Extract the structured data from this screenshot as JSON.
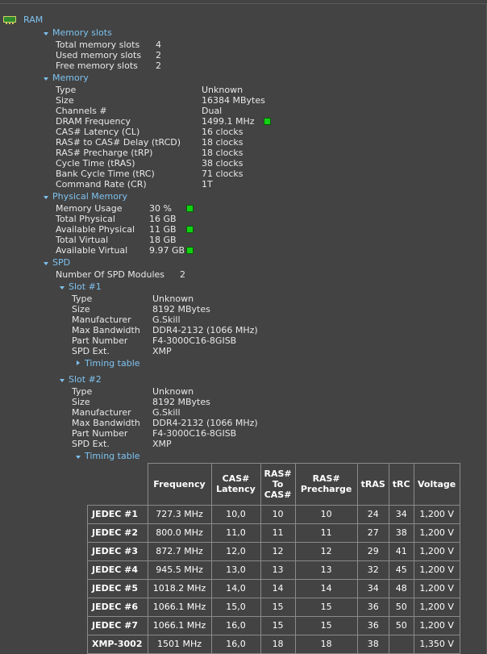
{
  "root": {
    "label": "RAM",
    "icon": "ram-icon"
  },
  "memory_slots": {
    "title": "Memory slots",
    "rows": [
      {
        "label": "Total memory slots",
        "value": "4"
      },
      {
        "label": "Used memory slots",
        "value": "2"
      },
      {
        "label": "Free memory slots",
        "value": "2"
      }
    ]
  },
  "memory": {
    "title": "Memory",
    "rows": [
      {
        "label": "Type",
        "value": "Unknown"
      },
      {
        "label": "Size",
        "value": "16384 MBytes"
      },
      {
        "label": "Channels #",
        "value": "Dual"
      },
      {
        "label": "DRAM Frequency",
        "value": "1499.1 MHz"
      },
      {
        "label": "CAS# Latency (CL)",
        "value": "16 clocks"
      },
      {
        "label": "RAS# to CAS# Delay (tRCD)",
        "value": "18 clocks"
      },
      {
        "label": "RAS# Precharge (tRP)",
        "value": "18 clocks"
      },
      {
        "label": "Cycle Time (tRAS)",
        "value": "38 clocks"
      },
      {
        "label": "Bank Cycle Time (tRC)",
        "value": "71 clocks"
      },
      {
        "label": "Command Rate (CR)",
        "value": "1T"
      }
    ]
  },
  "physical_memory": {
    "title": "Physical Memory",
    "rows": [
      {
        "label": "Memory Usage",
        "value": "30 %"
      },
      {
        "label": "Total Physical",
        "value": "16 GB"
      },
      {
        "label": "Available Physical",
        "value": "11 GB"
      },
      {
        "label": "Total Virtual",
        "value": "18 GB"
      },
      {
        "label": "Available Virtual",
        "value": "9.97 GB"
      }
    ]
  },
  "spd": {
    "title": "SPD",
    "modules_label": "Number Of SPD Modules",
    "modules_value": "2",
    "slot1": {
      "title": "Slot #1",
      "rows": [
        {
          "label": "Type",
          "value": "Unknown"
        },
        {
          "label": "Size",
          "value": "8192 MBytes"
        },
        {
          "label": "Manufacturer",
          "value": "G.Skill"
        },
        {
          "label": "Max Bandwidth",
          "value": "DDR4-2132 (1066 MHz)"
        },
        {
          "label": "Part Number",
          "value": "F4-3000C16-8GISB"
        },
        {
          "label": "SPD Ext.",
          "value": "XMP"
        }
      ],
      "timing_label": "Timing table"
    },
    "slot2": {
      "title": "Slot #2",
      "rows": [
        {
          "label": "Type",
          "value": "Unknown"
        },
        {
          "label": "Size",
          "value": "8192 MBytes"
        },
        {
          "label": "Manufacturer",
          "value": "G.Skill"
        },
        {
          "label": "Max Bandwidth",
          "value": "DDR4-2132 (1066 MHz)"
        },
        {
          "label": "Part Number",
          "value": "F4-3000C16-8GISB"
        },
        {
          "label": "SPD Ext.",
          "value": "XMP"
        }
      ],
      "timing_label": "Timing table"
    }
  },
  "timing_table": {
    "headers": {
      "frequency": "Frequency",
      "cas1": "CAS#",
      "cas2": "Latency",
      "rascas1": "RAS#",
      "rascas2": "To",
      "rascas3": "CAS#",
      "rasp1": "RAS#",
      "rasp2": "Precharge",
      "tras": "tRAS",
      "trc": "tRC",
      "voltage": "Voltage"
    },
    "rows": [
      {
        "name": "JEDEC #1",
        "freq": "727.3 MHz",
        "cl": "10,0",
        "rcd": "10",
        "rp": "10",
        "tras": "24",
        "trc": "34",
        "volt": "1,200 V"
      },
      {
        "name": "JEDEC #2",
        "freq": "800.0 MHz",
        "cl": "11,0",
        "rcd": "11",
        "rp": "11",
        "tras": "27",
        "trc": "38",
        "volt": "1,200 V"
      },
      {
        "name": "JEDEC #3",
        "freq": "872.7 MHz",
        "cl": "12,0",
        "rcd": "12",
        "rp": "12",
        "tras": "29",
        "trc": "41",
        "volt": "1,200 V"
      },
      {
        "name": "JEDEC #4",
        "freq": "945.5 MHz",
        "cl": "13,0",
        "rcd": "13",
        "rp": "13",
        "tras": "32",
        "trc": "45",
        "volt": "1,200 V"
      },
      {
        "name": "JEDEC #5",
        "freq": "1018.2 MHz",
        "cl": "14,0",
        "rcd": "14",
        "rp": "14",
        "tras": "34",
        "trc": "48",
        "volt": "1,200 V"
      },
      {
        "name": "JEDEC #6",
        "freq": "1066.1 MHz",
        "cl": "15,0",
        "rcd": "15",
        "rp": "15",
        "tras": "36",
        "trc": "50",
        "volt": "1,200 V"
      },
      {
        "name": "JEDEC #7",
        "freq": "1066.1 MHz",
        "cl": "16,0",
        "rcd": "15",
        "rp": "15",
        "tras": "36",
        "trc": "50",
        "volt": "1,200 V"
      },
      {
        "name": "XMP-3002",
        "freq": "1501 MHz",
        "cl": "16,0",
        "rcd": "18",
        "rp": "18",
        "tras": "38",
        "trc": "",
        "volt": "1,350 V"
      }
    ]
  },
  "colors": {
    "background": "#434343",
    "header": "#7ec3f0",
    "text": "#e8e8e8",
    "gauge": "#12d012"
  }
}
